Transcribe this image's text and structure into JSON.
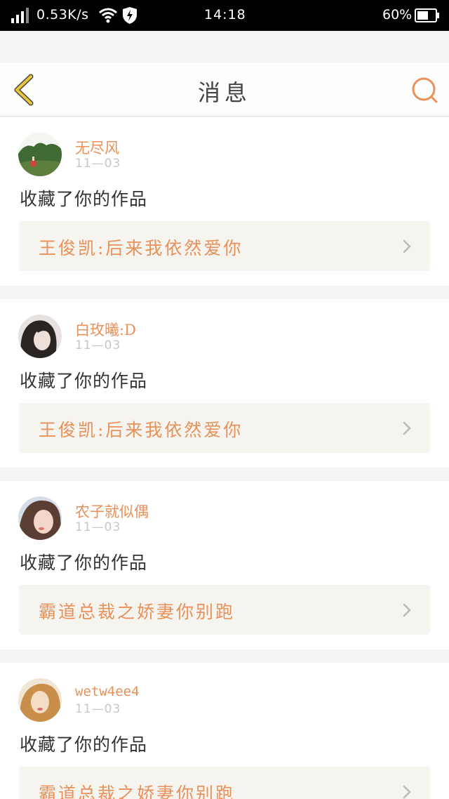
{
  "status_bar": {
    "speed": "0.53K/s",
    "time": "14:18",
    "battery": "60%",
    "icons": [
      "signal-icon",
      "wifi-icon",
      "shield-bolt-icon",
      "battery-icon"
    ]
  },
  "header": {
    "title": "消息",
    "back_icon": "chevron-left-icon",
    "search_icon": "search-icon"
  },
  "colors": {
    "accent": "#e8915a",
    "back_arrow": "#e8c63a",
    "card_link_bg": "#f5f4ef",
    "page_bg": "#f4f4f4"
  },
  "notifications": [
    {
      "user": "无尽风",
      "date": "11—03",
      "action": "收藏了你的作品",
      "work": "王俊凯:后来我依然爱你"
    },
    {
      "user": "白玫曦:D",
      "date": "11—03",
      "action": "收藏了你的作品",
      "work": "王俊凯:后来我依然爱你"
    },
    {
      "user": "农子就似偶",
      "date": "11—03",
      "action": "收藏了你的作品",
      "work": "霸道总裁之娇妻你别跑"
    },
    {
      "user": "wetw4ee4",
      "date": "11—03",
      "action": "收藏了你的作品",
      "work": "霸道总裁之娇妻你别跑"
    }
  ]
}
